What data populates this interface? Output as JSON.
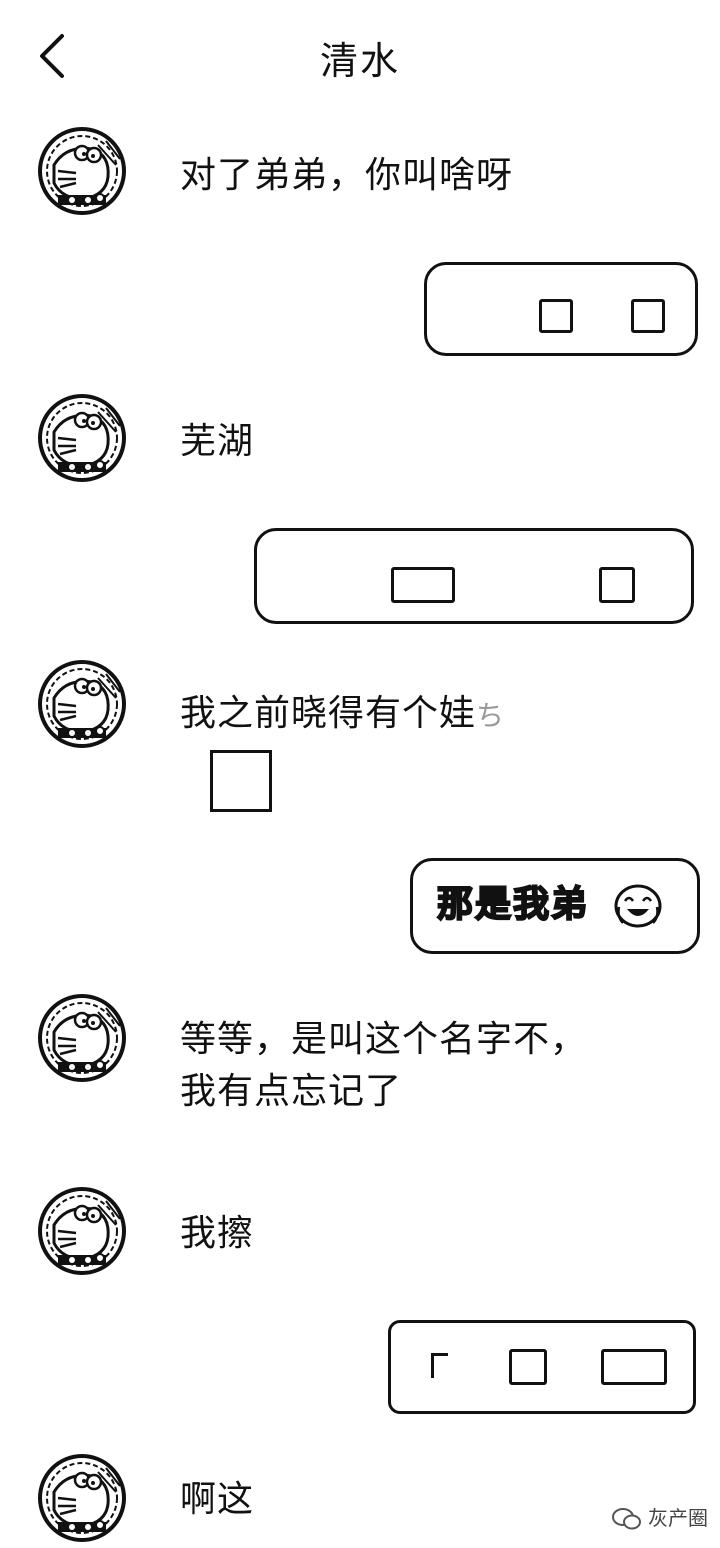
{
  "header": {
    "title": "清水"
  },
  "messages": {
    "m1": "对了弟弟，你叫啥呀",
    "m3": "芜湖",
    "m5": "我之前晓得有个娃",
    "m5_cut": "ち",
    "m6": "那是我弟",
    "m7_line1": "等等，是叫这个名字不，",
    "m7_line2": "我有点忘记了",
    "m8": "我擦",
    "m10": "啊这"
  },
  "watermark": {
    "text": "灰产圈"
  },
  "icons": {
    "back": "chevron-left-icon",
    "avatar": "doraemon-avatar-icon",
    "emoji": "laughing-cry-emoji-icon",
    "watermark": "wechat-logo-icon"
  }
}
